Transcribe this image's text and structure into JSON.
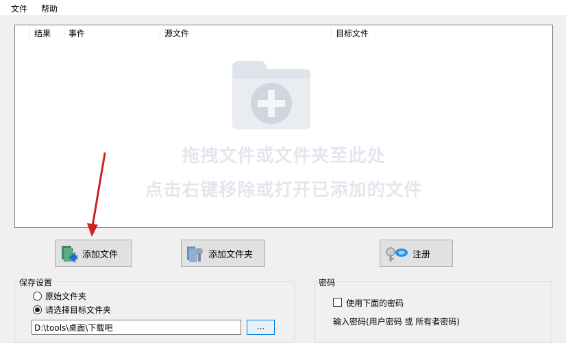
{
  "menu": {
    "file": "文件",
    "help": "帮助"
  },
  "columns": {
    "result": "结果",
    "event": "事件",
    "source": "源文件",
    "target": "目标文件"
  },
  "drop_hint": {
    "line1": "拖拽文件或文件夹至此处",
    "line2": "点击右键移除或打开已添加的文件"
  },
  "buttons": {
    "add_file": "添加文件",
    "add_folder": "添加文件夹",
    "register": "注册"
  },
  "save_settings": {
    "title": "保存设置",
    "option_original": "原始文件夹",
    "option_target": "请选择目标文件夹",
    "selected": "target",
    "path_value": "D:\\tools\\桌面\\下载吧",
    "browse_label": "..."
  },
  "password": {
    "title": "密码",
    "use_password_label": "使用下面的密码",
    "use_password_checked": false,
    "input_label": "输入密码(用户密码 或 所有者密码)"
  },
  "colors": {
    "annotation_arrow": "#d21f1f",
    "hint_text": "#e2e7ee"
  }
}
